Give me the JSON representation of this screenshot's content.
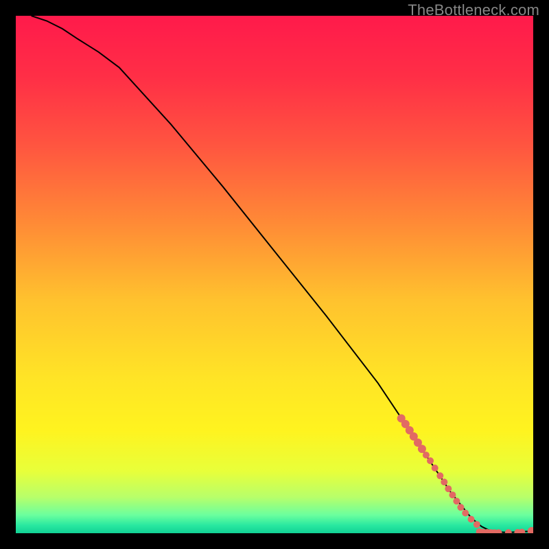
{
  "watermark": "TheBottleneck.com",
  "chart_data": {
    "type": "line",
    "title": "",
    "xlabel": "",
    "ylabel": "",
    "xlim": [
      0,
      100
    ],
    "ylim": [
      0,
      100
    ],
    "gradient_stops": [
      {
        "offset": 0,
        "color": "#ff1a4b"
      },
      {
        "offset": 0.12,
        "color": "#ff2f46"
      },
      {
        "offset": 0.25,
        "color": "#ff5540"
      },
      {
        "offset": 0.4,
        "color": "#ff8a36"
      },
      {
        "offset": 0.55,
        "color": "#ffc22e"
      },
      {
        "offset": 0.7,
        "color": "#ffe426"
      },
      {
        "offset": 0.8,
        "color": "#fff31f"
      },
      {
        "offset": 0.88,
        "color": "#e8ff3a"
      },
      {
        "offset": 0.93,
        "color": "#b8ff6a"
      },
      {
        "offset": 0.965,
        "color": "#6bff9e"
      },
      {
        "offset": 0.985,
        "color": "#28e8a0"
      },
      {
        "offset": 1.0,
        "color": "#11d195"
      }
    ],
    "series": [
      {
        "name": "curve",
        "type": "line",
        "color": "#000000",
        "x": [
          3,
          6,
          9,
          12,
          16,
          20,
          30,
          40,
          50,
          60,
          70,
          74,
          78,
          82,
          84,
          86,
          88,
          90,
          92,
          95,
          100
        ],
        "y": [
          100,
          99,
          97.5,
          95.5,
          93,
          90,
          79,
          67,
          54.5,
          42,
          29,
          23,
          17,
          11,
          8,
          5.5,
          3,
          1.3,
          0.3,
          0.15,
          0.4
        ]
      },
      {
        "name": "markers",
        "type": "scatter",
        "color": "#e26a63",
        "points": [
          {
            "x": 74.5,
            "y": 22.2,
            "r": 6
          },
          {
            "x": 75.3,
            "y": 21.1,
            "r": 6
          },
          {
            "x": 76.1,
            "y": 19.9,
            "r": 6
          },
          {
            "x": 76.9,
            "y": 18.7,
            "r": 6
          },
          {
            "x": 77.7,
            "y": 17.5,
            "r": 6
          },
          {
            "x": 78.5,
            "y": 16.3,
            "r": 6
          },
          {
            "x": 79.3,
            "y": 15.1,
            "r": 5
          },
          {
            "x": 80.1,
            "y": 14.0,
            "r": 5
          },
          {
            "x": 81.0,
            "y": 12.6,
            "r": 5
          },
          {
            "x": 82.0,
            "y": 11.1,
            "r": 5
          },
          {
            "x": 82.8,
            "y": 9.9,
            "r": 5
          },
          {
            "x": 83.6,
            "y": 8.6,
            "r": 5
          },
          {
            "x": 84.4,
            "y": 7.4,
            "r": 5
          },
          {
            "x": 85.2,
            "y": 6.2,
            "r": 5
          },
          {
            "x": 86.0,
            "y": 5.0,
            "r": 5
          },
          {
            "x": 86.9,
            "y": 3.9,
            "r": 5
          },
          {
            "x": 88.0,
            "y": 2.7,
            "r": 5
          },
          {
            "x": 89.1,
            "y": 1.7,
            "r": 5
          },
          {
            "x": 89.6,
            "y": 0.3,
            "r": 5
          },
          {
            "x": 90.3,
            "y": 0.2,
            "r": 5
          },
          {
            "x": 91.1,
            "y": 0.15,
            "r": 5
          },
          {
            "x": 91.8,
            "y": 0.12,
            "r": 5
          },
          {
            "x": 92.5,
            "y": 0.1,
            "r": 5
          },
          {
            "x": 93.3,
            "y": 0.1,
            "r": 5
          },
          {
            "x": 95.2,
            "y": 0.12,
            "r": 5
          },
          {
            "x": 97.0,
            "y": 0.15,
            "r": 5
          },
          {
            "x": 97.8,
            "y": 0.2,
            "r": 5
          },
          {
            "x": 99.7,
            "y": 0.4,
            "r": 6
          }
        ]
      }
    ]
  }
}
